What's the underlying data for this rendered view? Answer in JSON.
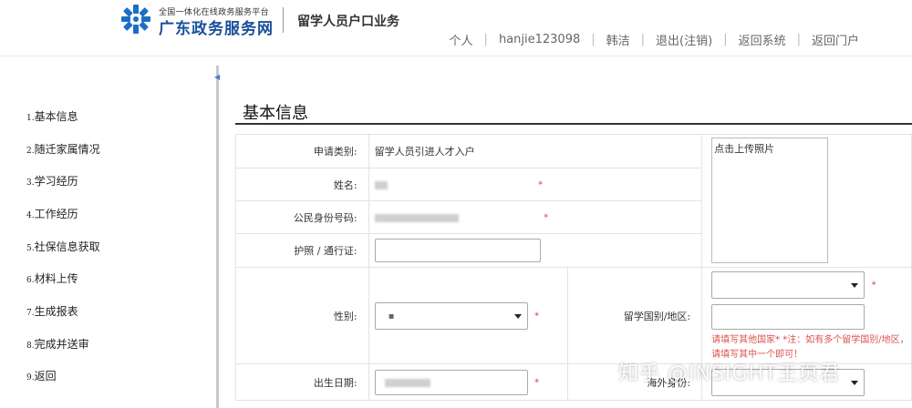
{
  "header": {
    "portal_subtitle": "全国一体化在线政务服务平台",
    "portal_name": "广东政务服务网",
    "service_name": "留学人员户口业务",
    "nav": [
      "个人",
      "hanjie123098",
      "韩洁",
      "退出(注销)",
      "返回系统",
      "返回门户"
    ],
    "logo_icon": "snowflake-logo-icon",
    "brand_color": "#1a4f9c"
  },
  "sidebar": {
    "items": [
      {
        "num": "1.",
        "label": "基本信息"
      },
      {
        "num": "2.",
        "label": "随迁家属情况"
      },
      {
        "num": "3.",
        "label": "学习经历"
      },
      {
        "num": "4.",
        "label": "工作经历"
      },
      {
        "num": "5.",
        "label": "社保信息获取"
      },
      {
        "num": "6.",
        "label": "材料上传"
      },
      {
        "num": "7.",
        "label": "生成报表"
      },
      {
        "num": "8.",
        "label": "完成并送审"
      },
      {
        "num": "9.",
        "label": "返回"
      }
    ]
  },
  "main": {
    "title": "基本信息",
    "fields": {
      "category_label": "申请类别:",
      "category_value": "留学人员引进人才入户",
      "name_label": "姓名:",
      "id_label": "公民身份号码:",
      "passport_label": "护照 / 通行证:",
      "gender_label": "性别:",
      "country_label": "留学国别/地区:",
      "birth_label": "出生日期:",
      "overseas_label": "海外身份:",
      "required_mark": "*"
    },
    "photo_upload_label": "点击上传照片",
    "country_note": "请填写其他国家* *注：如有多个留学国别/地区，请填写其中一个即可！"
  },
  "watermark": "知乎 @INSIGHT王页君"
}
